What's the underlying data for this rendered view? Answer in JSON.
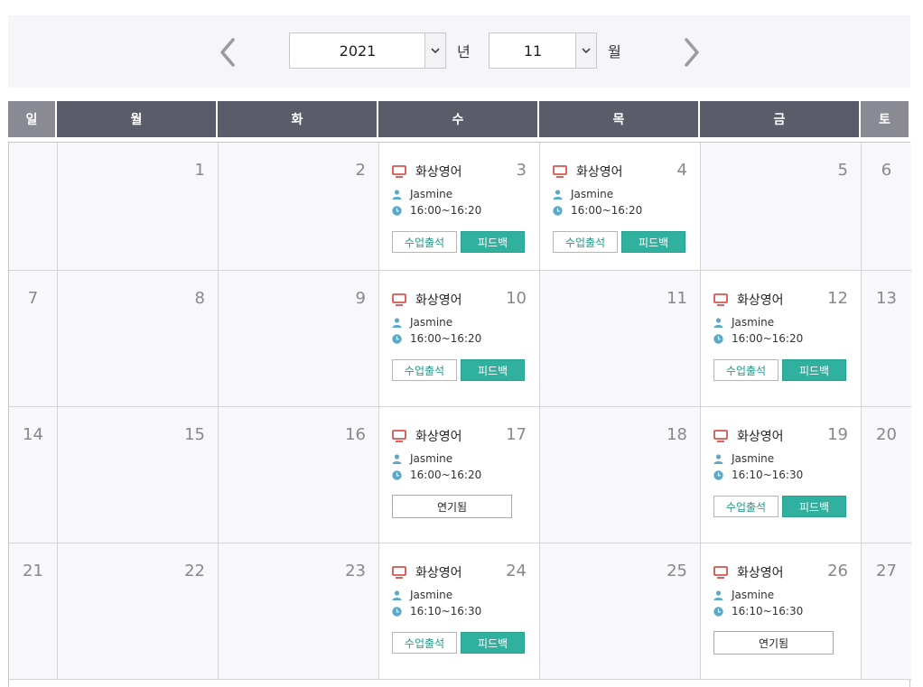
{
  "nav": {
    "year": "2021",
    "year_unit": "년",
    "month": "11",
    "month_unit": "월"
  },
  "weekdays": [
    "일",
    "월",
    "화",
    "수",
    "목",
    "금",
    "토"
  ],
  "colors": {
    "header": "#5b5c69",
    "header_weekend": "#8a8a95",
    "accent": "#30b19f",
    "monitor_icon": "#d9534f",
    "person_icon": "#5aa9c9"
  },
  "weeks": [
    [
      {
        "day": "",
        "event": null
      },
      {
        "day": "1",
        "event": null
      },
      {
        "day": "2",
        "event": null
      },
      {
        "day": "3",
        "event": {
          "title": "화상영어",
          "teacher": "Jasmine",
          "time": "16:00~16:20",
          "status": "attended",
          "attend_label": "수업출석",
          "feedback_label": "피드백"
        }
      },
      {
        "day": "4",
        "event": {
          "title": "화상영어",
          "teacher": "Jasmine",
          "time": "16:00~16:20",
          "status": "attended",
          "attend_label": "수업출석",
          "feedback_label": "피드백"
        }
      },
      {
        "day": "5",
        "event": null
      },
      {
        "day": "6",
        "event": null
      }
    ],
    [
      {
        "day": "7",
        "event": null
      },
      {
        "day": "8",
        "event": null
      },
      {
        "day": "9",
        "event": null
      },
      {
        "day": "10",
        "event": {
          "title": "화상영어",
          "teacher": "Jasmine",
          "time": "16:00~16:20",
          "status": "attended",
          "attend_label": "수업출석",
          "feedback_label": "피드백"
        }
      },
      {
        "day": "11",
        "event": null
      },
      {
        "day": "12",
        "event": {
          "title": "화상영어",
          "teacher": "Jasmine",
          "time": "16:00~16:20",
          "status": "attended",
          "attend_label": "수업출석",
          "feedback_label": "피드백"
        }
      },
      {
        "day": "13",
        "event": null
      }
    ],
    [
      {
        "day": "14",
        "event": null
      },
      {
        "day": "15",
        "event": null
      },
      {
        "day": "16",
        "event": null
      },
      {
        "day": "17",
        "event": {
          "title": "화상영어",
          "teacher": "Jasmine",
          "time": "16:00~16:20",
          "status": "postponed",
          "postponed_label": "연기됨"
        }
      },
      {
        "day": "18",
        "event": null
      },
      {
        "day": "19",
        "event": {
          "title": "화상영어",
          "teacher": "Jasmine",
          "time": "16:10~16:30",
          "status": "attended",
          "attend_label": "수업출석",
          "feedback_label": "피드백"
        }
      },
      {
        "day": "20",
        "event": null
      }
    ],
    [
      {
        "day": "21",
        "event": null
      },
      {
        "day": "22",
        "event": null
      },
      {
        "day": "23",
        "event": null
      },
      {
        "day": "24",
        "event": {
          "title": "화상영어",
          "teacher": "Jasmine",
          "time": "16:10~16:30",
          "status": "attended",
          "attend_label": "수업출석",
          "feedback_label": "피드백"
        }
      },
      {
        "day": "25",
        "event": null
      },
      {
        "day": "26",
        "event": {
          "title": "화상영어",
          "teacher": "Jasmine",
          "time": "16:10~16:30",
          "status": "postponed",
          "postponed_label": "연기됨"
        }
      },
      {
        "day": "27",
        "event": null
      }
    ]
  ]
}
